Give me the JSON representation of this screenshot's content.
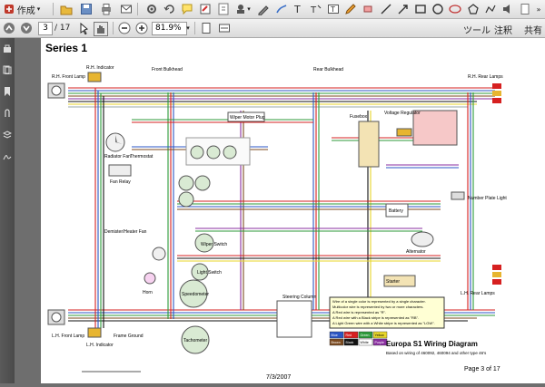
{
  "toolbar": {
    "create_label": "作成",
    "tools_label": "ツール",
    "comment_label": "注釈",
    "share_label": "共有",
    "page_current": "3",
    "page_total": "/ 17",
    "zoom": "81.9%"
  },
  "document": {
    "series_title": "Series 1",
    "date": "7/3/2007",
    "page_label": "Page 3 of 17",
    "diagram_title": "Europa S1 Wiring Diagram",
    "diagram_subtitle": "Based on wiring of 460092, 460094 and other type 46's",
    "labels": {
      "rh_indicator": "R.H. Indicator",
      "rh_front_lamp": "R.H. Front Lamp",
      "front_bulkhead": "Front Bulkhead",
      "rear_bulkhead": "Rear Bulkhead",
      "rh_rear_lamps": "R.H. Rear Lamps",
      "wiper_motor_plug": "Wiper Motor Plug",
      "fusebox": "Fusebox",
      "voltage_regulator": "Voltage Regulator",
      "radiator_fan": "Radiator Fan",
      "thermostat": "Thermostat",
      "fan_relay": "Fan Relay",
      "number_plate_light": "Number Plate Light",
      "demister": "Demister/Heater Fan",
      "wiper_switch": "Wiper Switch",
      "light_switch": "Light Switch",
      "horn": "Horn",
      "speedometer": "Speedometer",
      "battery": "Battery",
      "starter": "Starter",
      "alternator": "Alternator",
      "steering_column": "Steering Column",
      "tachometer": "Tachometer",
      "frame_ground": "Frame Ground",
      "lh_rear_lamps": "L.H. Rear Lamps",
      "lh_front_lamp": "L.H. Front Lamp",
      "lh_indicator": "L.H. Indicator"
    },
    "notes": [
      "Wire of a single color is represented by a single character.",
      "Multicolor wire is represented by two or more characters.",
      "A Red wire is represented as \"R\".",
      "A Red wire with a Black stripe is represented as \"RB\".",
      "A Light Green wire with a White stripe is represented as \"LGW\"."
    ],
    "legend_colors": [
      {
        "name": "Blue",
        "hex": "#2b55c4"
      },
      {
        "name": "Red",
        "hex": "#d62020"
      },
      {
        "name": "Green",
        "hex": "#2c9a3a"
      },
      {
        "name": "Yellow",
        "hex": "#e8d62a"
      },
      {
        "name": "Brown",
        "hex": "#7b4a1f"
      },
      {
        "name": "Black",
        "hex": "#111111"
      },
      {
        "name": "White",
        "hex": "#ffffff"
      },
      {
        "name": "Purple",
        "hex": "#8a2fa0"
      }
    ]
  },
  "icons": [
    "back-icon",
    "save-icon",
    "print-icon",
    "mail-icon",
    "settings-icon",
    "undo-icon",
    "comment-icon",
    "highlight-icon",
    "attach-icon",
    "stamp-icon",
    "sign-icon",
    "text-icon",
    "select-icon",
    "hand-icon",
    "zoom-out-icon",
    "zoom-in-icon"
  ]
}
